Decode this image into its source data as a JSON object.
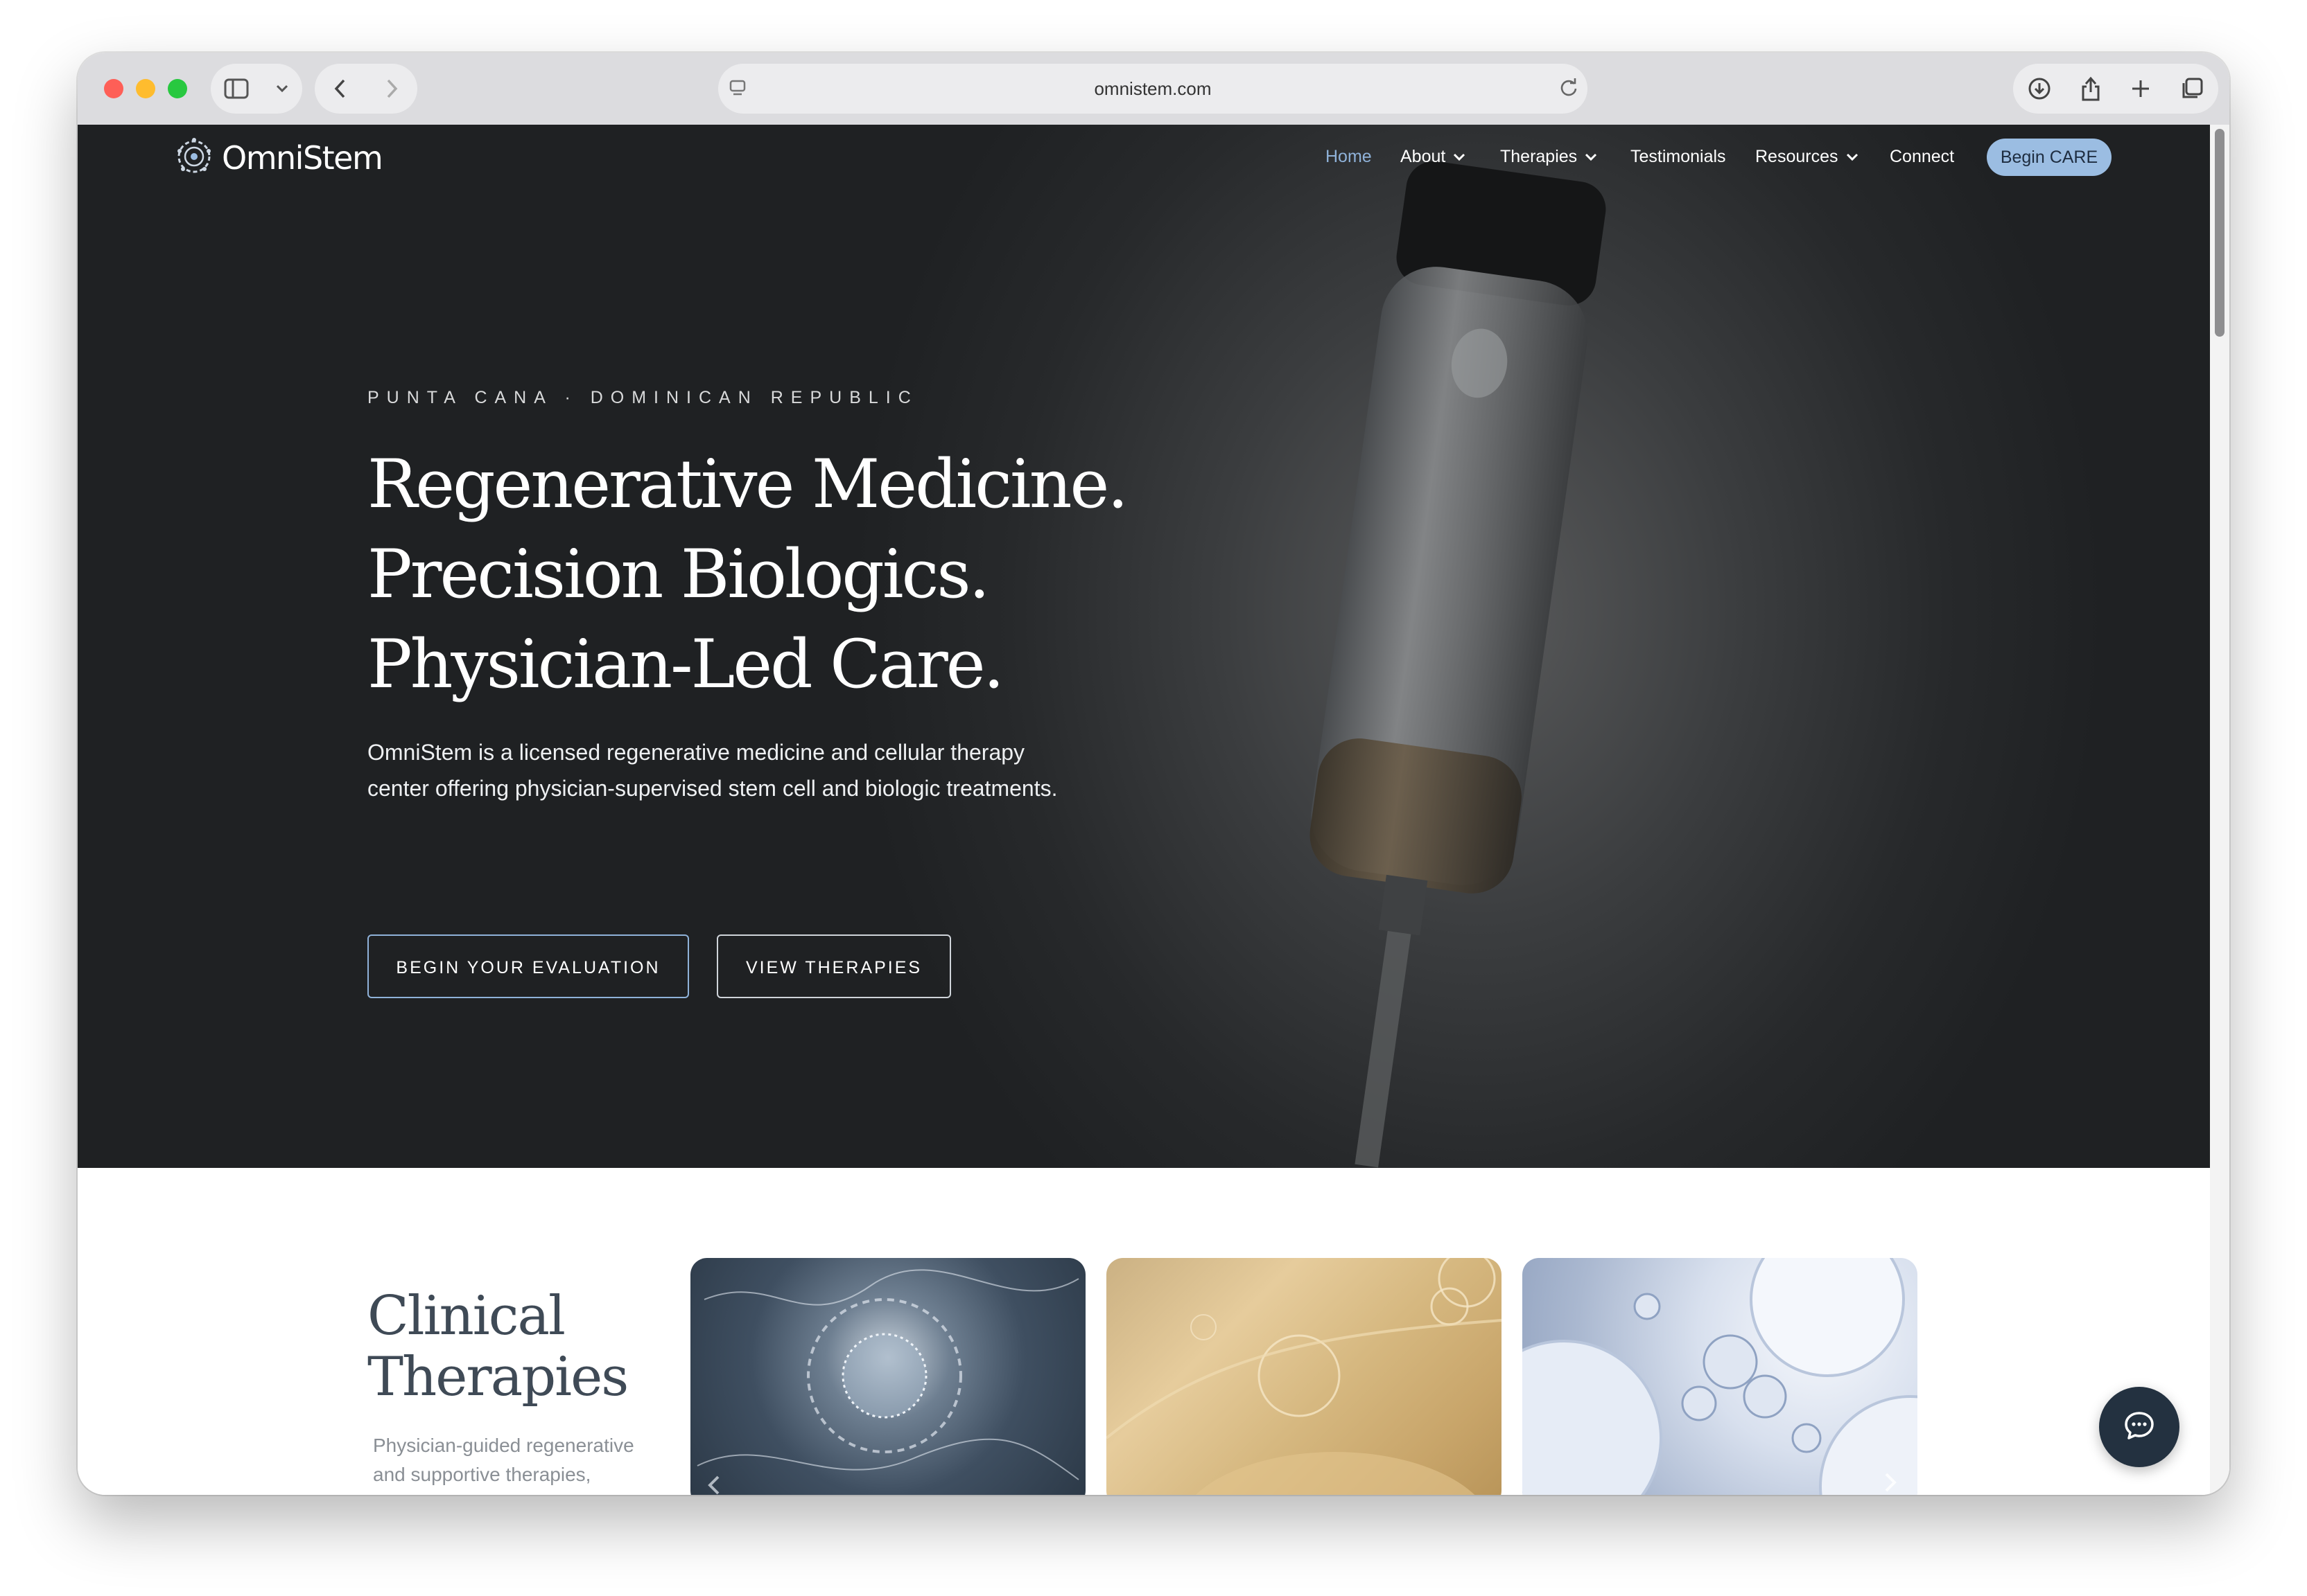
{
  "browser": {
    "url": "omnistem.com"
  },
  "site": {
    "logo_text": "OmniStem",
    "nav": {
      "home": "Home",
      "about": "About",
      "therapies": "Therapies",
      "testimonials": "Testimonials",
      "resources": "Resources",
      "connect": "Connect",
      "begin_care": "Begin CARE"
    }
  },
  "hero": {
    "eyebrow": "PUNTA CANA · DOMINICAN REPUBLIC",
    "headline": [
      "Regenerative Medicine.",
      "Precision Biologics.",
      "Physician-Led Care."
    ],
    "lede": "OmniStem is a licensed regenerative medicine and cellular therapy center offering physician-supervised stem cell and biologic treatments.",
    "cta_primary": "BEGIN YOUR EVALUATION",
    "cta_secondary": "VIEW THERAPIES"
  },
  "therapies": {
    "title_line1": "Clinical",
    "title_line2": "Therapies",
    "subtitle": "Physician-guided regenerative and supportive therapies,"
  },
  "colors": {
    "accent": "#8fb2d9",
    "hero_bg": "#27292b",
    "chat_button": "#233140"
  },
  "icons": {
    "logo": "cell-logo-icon",
    "chat": "chat-bubble-icon"
  }
}
